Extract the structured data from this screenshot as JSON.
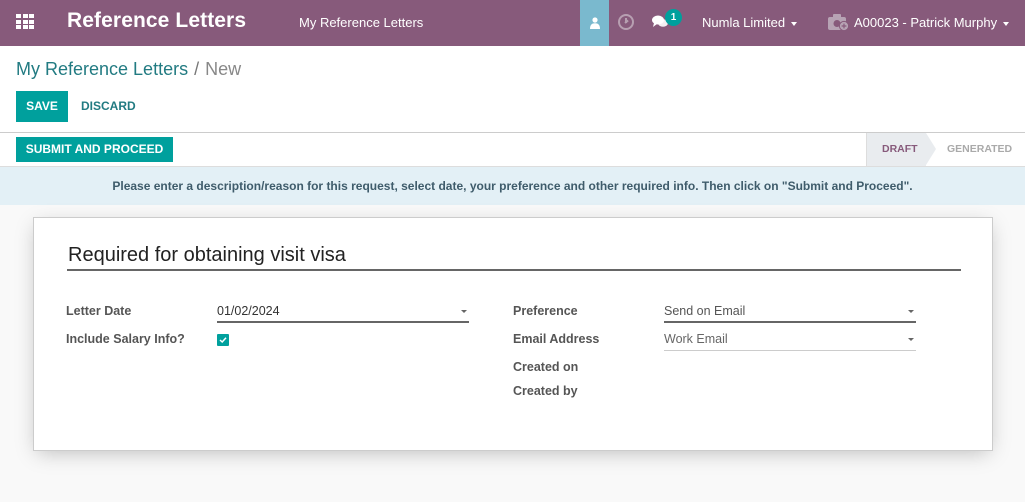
{
  "navbar": {
    "app_title": "Reference Letters",
    "menu_item": "My Reference Letters",
    "chat_badge_count": "1",
    "company": "Numla Limited",
    "user": "A00023 - Patrick Murphy",
    "colors": {
      "bar": "#875a7b",
      "active_user_tab": "#7ab9ce",
      "badge": "#00a09d"
    }
  },
  "breadcrumb": {
    "parent": "My Reference Letters",
    "separator": "/",
    "current": "New"
  },
  "toolbar": {
    "save_label": "SAVE",
    "discard_label": "DISCARD"
  },
  "statusbar": {
    "submit_label": "SUBMIT AND PROCEED",
    "stages": [
      {
        "label": "DRAFT",
        "active": true
      },
      {
        "label": "GENERATED",
        "active": false
      }
    ]
  },
  "alert": {
    "message": "Please enter a description/reason for this request, select date, your preference and other required info. Then click on \"Submit and Proceed\"."
  },
  "form": {
    "title_value": "Required for obtaining visit visa",
    "left": {
      "letter_date_label": "Letter Date",
      "letter_date_value": "01/02/2024",
      "include_salary_label": "Include Salary Info?",
      "include_salary_checked": true
    },
    "right": {
      "preference_label": "Preference",
      "preference_value": "Send on Email",
      "email_address_label": "Email Address",
      "email_address_value": "Work Email",
      "created_on_label": "Created on",
      "created_by_label": "Created by"
    }
  },
  "accent_color": "#00a09d"
}
